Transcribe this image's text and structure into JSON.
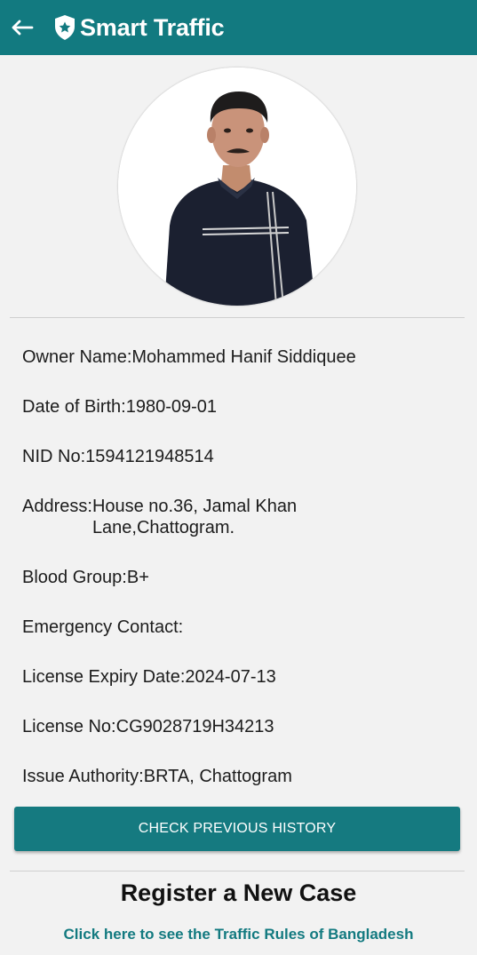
{
  "app_bar": {
    "title": "Smart Traffic",
    "back_icon": "arrow-left-icon",
    "logo_icon": "police-badge-star-icon",
    "color": "#127a80"
  },
  "profile": {
    "photo": "owner-photo"
  },
  "details": {
    "owner_name_label": "Owner Name: ",
    "owner_name": "Mohammed Hanif Siddiquee",
    "dob_label": "Date of Birth: ",
    "dob": "1980-09-01",
    "nid_label": "NID No: ",
    "nid": "1594121948514",
    "address_label": "Address: ",
    "address": "House no.36, Jamal Khan Lane,Chattogram.",
    "blood_group_label": "Blood Group: ",
    "blood_group": "B+",
    "emergency_contact_label": "Emergency Contact:",
    "emergency_contact": "",
    "license_expiry_label": "License Expiry Date: ",
    "license_expiry": "2024-07-13",
    "license_no_label": "License No: ",
    "license_no": "CG9028719H34213",
    "issue_authority_label": "Issue Authority: ",
    "issue_authority": "BRTA, Chattogram"
  },
  "actions": {
    "check_history": "CHECK PREVIOUS HISTORY",
    "register_case": "Register a New Case",
    "traffic_rules_link": "Click here to see the Traffic Rules of Bangladesh"
  }
}
